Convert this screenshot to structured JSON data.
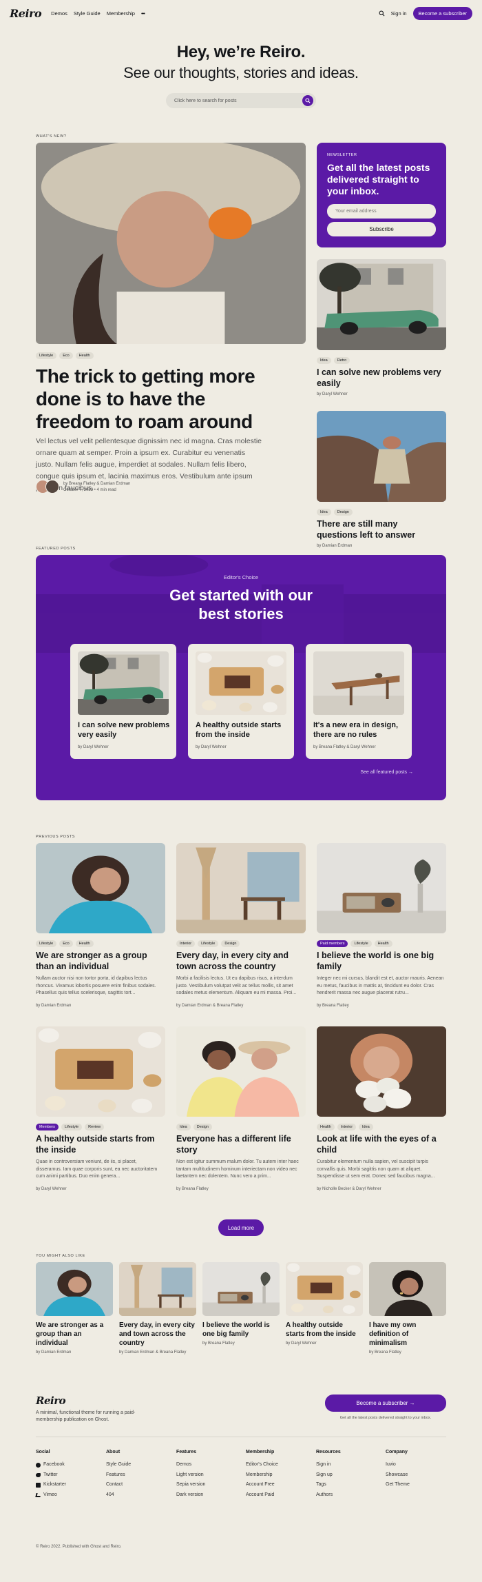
{
  "header": {
    "logo": "Reiro",
    "nav": [
      "Demos",
      "Style Guide",
      "Membership"
    ],
    "more": "•••",
    "signin": "Sign in",
    "subscribe": "Become a subscriber"
  },
  "hero": {
    "title": "Hey, we’re Reiro.",
    "subtitle": "See our thoughts, stories and ideas.",
    "search_placeholder": "Click here to search for posts"
  },
  "whats_new": {
    "label": "WHAT'S NEW?",
    "main": {
      "tags": [
        "Lifestyle",
        "Eco",
        "Health"
      ],
      "title": "The trick to getting more done is to have the freedom to roam around",
      "excerpt": "Vel lectus vel velit pellentesque dignissim nec id magna. Cras molestie ornare quam at semper. Proin a ipsum ex. Curabitur eu venenatis justo. Nullam felis augue, imperdiet at sodales. Nullam felis libero, congue quis ipsum et, lacinia maximus eros. Vestibulum ante ipsum primis in faucibus.",
      "authors": "by Breana Flatley & Damian Erdman",
      "date": "October 7, 2022 • 4 min read"
    },
    "newsletter": {
      "label": "NEWSLETTER",
      "title": "Get all the latest posts delivered straight to your inbox.",
      "placeholder": "Your email address",
      "button": "Subscribe"
    },
    "side": [
      {
        "tags": [
          "Idea",
          "Retro"
        ],
        "title": "I can solve new problems very easily",
        "author": "by Daryl Wehner"
      },
      {
        "tags": [
          "Idea",
          "Design"
        ],
        "title": "There are still many questions left to answer",
        "author": "by Damian Erdman"
      }
    ]
  },
  "featured": {
    "label": "FEATURED POSTS",
    "kicker": "Editor's Choice",
    "title": "Get started with our best stories",
    "cards": [
      {
        "title": "I can solve new problems very easily",
        "author": "by Daryl Wehner"
      },
      {
        "title": "A healthy outside starts from the inside",
        "author": "by Daryl Wehner"
      },
      {
        "title": "It's a new era in design, there are no rules",
        "author": "by Breana Flatley & Daryl Wehner"
      }
    ],
    "see_all": "See all featured posts →"
  },
  "previous": {
    "label": "PREVIOUS POSTS",
    "posts": [
      {
        "tags": [
          "Lifestyle",
          "Eco",
          "Health"
        ],
        "title": "We are stronger as a group than an individual",
        "excerpt": "Nullam auctor nisi non tortor porta, id dapibus lectus rhoncus. Vivamus lobortis posuere enim finibus sodales. Phasellus quis tellus scelerisque, sagittis tort...",
        "author": "by Damian Erdman"
      },
      {
        "tags": [
          "Interior",
          "Lifestyle",
          "Design"
        ],
        "title": "Every day, in every city and town across the country",
        "excerpt": "Morbi a facilisis lectus. Ut eu dapibus risus, a interdum justo. Vestibulum volutpat velit ac tellus mollis, sit amet sodales metus elementum. Aliquam eu mi massa. Proi...",
        "author": "by Damian Erdman & Breana Flatley"
      },
      {
        "tags": [
          "Paid members",
          "Lifestyle",
          "Health"
        ],
        "title": "I believe the world is one big family",
        "excerpt": "Integer nec mi cursus, blandit est et, auctor mauris. Aenean eu metus, faucibus in mattis at, tincidunt eu dolor. Cras hendrerit massa nec augue placerat rutru...",
        "author": "by Breana Flatley"
      },
      {
        "tags": [
          "Members",
          "Lifestyle",
          "Review"
        ],
        "title": "A healthy outside starts from the inside",
        "excerpt": "Quae in controversiam veniunt, de iis, si placet, disseramus. Iam quae corporis sunt, ea nec auctoritatem cum animi partibus. Duo enim genera...",
        "author": "by Daryl Wehner"
      },
      {
        "tags": [
          "Idea",
          "Design"
        ],
        "title": "Everyone has a different life story",
        "excerpt": "Non est igitur summum malum dolor. Tu autem inter haec tantam multitudinem hominum interiectam non video nec laetantem nec dolentem. Nunc vero a prim...",
        "author": "by Breana Flatley"
      },
      {
        "tags": [
          "Health",
          "Interior",
          "Idea"
        ],
        "title": "Look at life with the eyes of a child",
        "excerpt": "Curabitur elementum nulla sapien, vel suscipit turpis convallis quis. Morbi sagittis non quam at aliquet. Suspendisse ut sem erat. Donec sed faucibus magna...",
        "author": "by Nicholle Becker & Daryl Wehner"
      }
    ],
    "load_more": "Load more"
  },
  "also_like": {
    "label": "YOU MIGHT ALSO LIKE",
    "posts": [
      {
        "title": "We are stronger as a group than an individual",
        "author": "by Damian Erdman"
      },
      {
        "title": "Every day, in every city and town across the country",
        "author": "by Damian Erdman & Breana Flatley"
      },
      {
        "title": "I believe the world is one big family",
        "author": "by Breana Flatley"
      },
      {
        "title": "A healthy outside starts from the inside",
        "author": "by Daryl Wehner"
      },
      {
        "title": "I have my own definition of minimalism",
        "author": "by Breana Flatley"
      }
    ]
  },
  "footer": {
    "logo": "Reiro",
    "description": "A minimal, functional theme for running a paid-membership publication on Ghost.",
    "subscribe": "Become a subscriber →",
    "subscribe_note": "Get all the latest posts delivered straight to your inbox.",
    "columns": [
      {
        "title": "Social",
        "items": [
          "Facebook",
          "Twitter",
          "Kickstarter",
          "Vimeo"
        ],
        "icons": [
          "facebook-icon",
          "twitter-icon",
          "kickstarter-icon",
          "vimeo-icon"
        ]
      },
      {
        "title": "About",
        "items": [
          "Style Guide",
          "Features",
          "Contact",
          "404"
        ]
      },
      {
        "title": "Features",
        "items": [
          "Demos",
          "Light version",
          "Sepia version",
          "Dark version"
        ]
      },
      {
        "title": "Membership",
        "items": [
          "Editor's Choice",
          "Membership",
          "Account Free",
          "Account Paid"
        ]
      },
      {
        "title": "Resources",
        "items": [
          "Sign in",
          "Sign up",
          "Tags",
          "Authors"
        ]
      },
      {
        "title": "Company",
        "items": [
          "Iuvio",
          "Showcase",
          "Get Theme"
        ]
      }
    ],
    "copyright": "© Reiro 2022. Published with Ghost and Reiro."
  },
  "colors": {
    "accent": "#5b1aa6",
    "background": "#efece3",
    "text": "#15171a"
  }
}
